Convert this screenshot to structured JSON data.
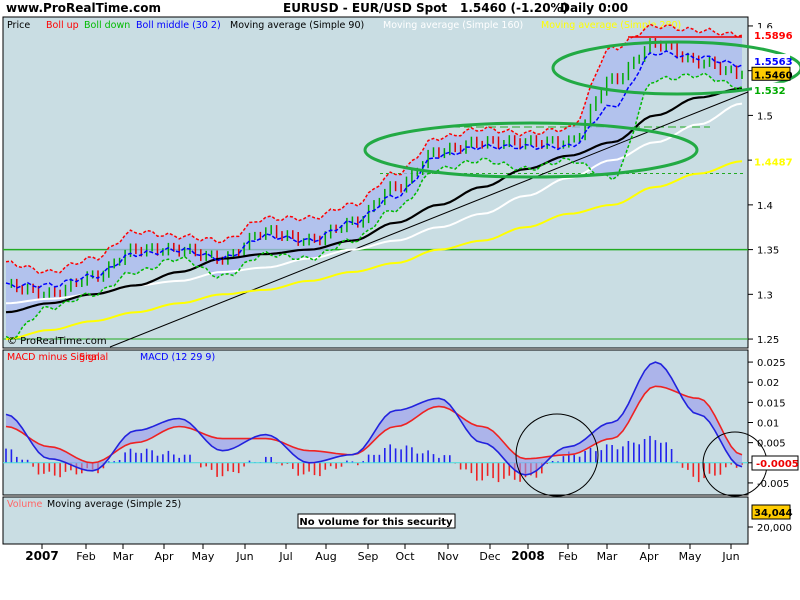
{
  "header": {
    "site": "www.ProRealTime.com",
    "symbol": "EURUSD - EUR/USD Spot",
    "quote": "1.5460 (-1.20%)",
    "period": "Daily 0:00"
  },
  "watermark": "© ProRealTime.com",
  "price_panel": {
    "legend": [
      {
        "label": "Price",
        "color": "#000000"
      },
      {
        "label": "Boll up",
        "color": "#ff0000"
      },
      {
        "label": "Boll down",
        "color": "#00bb00"
      },
      {
        "label": "Boll middle (30 2)",
        "color": "#0000ff"
      },
      {
        "label": "Moving average (Simple 90)",
        "color": "#000000"
      },
      {
        "label": "Moving average (Simple 160)",
        "color": "#ffffff"
      },
      {
        "label": "Moving average (Simple 280)",
        "color": "#ffff00"
      }
    ],
    "ticks": [
      "1.6",
      "1.55",
      "1.5",
      "1.45",
      "1.4",
      "1.35",
      "1.3",
      "1.25"
    ],
    "labels": [
      {
        "text": "1.5896",
        "bg": "#ffffff",
        "fg": "#ff0000"
      },
      {
        "text": "1.5563",
        "bg": "#ffffff",
        "fg": "#0000ff"
      },
      {
        "text": "1.5460",
        "bg": "#ffcc00",
        "fg": "#000000"
      },
      {
        "text": "1.532",
        "bg": "#ffffff",
        "fg": "#00aa00"
      },
      {
        "text": "1.5132",
        "bg": "#ffffff",
        "fg": "#ffffff"
      },
      {
        "text": "1.4487",
        "bg": "#ffffff",
        "fg": "#ffff00"
      }
    ]
  },
  "macd_panel": {
    "legend": [
      {
        "label": "MACD minus Signal",
        "color": "#ff0000"
      },
      {
        "label": "Signal",
        "color": "#ff0000"
      },
      {
        "label": "MACD (12 29 9)",
        "color": "#0000ff"
      }
    ],
    "ticks": [
      "0.025",
      "0.02",
      "0.015",
      "0.01",
      "0.005",
      "0",
      "-0.005"
    ],
    "value_label": "-0.0005"
  },
  "volume_panel": {
    "legend": [
      {
        "label": "Volume",
        "color": "#ff6666"
      },
      {
        "label": "Moving average (Simple 25)",
        "color": "#000000"
      }
    ],
    "message": "No volume for this security",
    "value_label": "34,044",
    "tick": "20,000"
  },
  "x_axis": {
    "labels": [
      "2007",
      "Feb",
      "Mar",
      "Apr",
      "May",
      "Jun",
      "Jul",
      "Aug",
      "Sep",
      "Oct",
      "Nov",
      "Dec",
      "2008",
      "Feb",
      "Mar",
      "Apr",
      "May",
      "Jun"
    ]
  },
  "colors": {
    "panel_bg": "#c9dde3",
    "band_fill": "#aab8f0",
    "annotation_green": "#22aa44"
  },
  "chart_data": [
    {
      "type": "line",
      "title": "EURUSD - EUR/USD Spot",
      "x": [
        "2007-01",
        "2007-02",
        "2007-03",
        "2007-04",
        "2007-05",
        "2007-06",
        "2007-07",
        "2007-08",
        "2007-09",
        "2007-10",
        "2007-11",
        "2007-12",
        "2008-01",
        "2008-02",
        "2008-03",
        "2008-04",
        "2008-05",
        "2008-06"
      ],
      "ylim": [
        1.24,
        1.61
      ],
      "series": [
        {
          "name": "Price",
          "values": [
            1.31,
            1.3,
            1.32,
            1.35,
            1.35,
            1.34,
            1.37,
            1.36,
            1.38,
            1.42,
            1.46,
            1.47,
            1.47,
            1.47,
            1.54,
            1.58,
            1.56,
            1.546
          ]
        },
        {
          "name": "Boll up",
          "values": [
            1.335,
            1.325,
            1.34,
            1.37,
            1.365,
            1.36,
            1.385,
            1.385,
            1.4,
            1.435,
            1.475,
            1.485,
            1.48,
            1.485,
            1.575,
            1.6,
            1.595,
            1.5896
          ]
        },
        {
          "name": "Boll down",
          "values": [
            1.25,
            1.285,
            1.3,
            1.325,
            1.34,
            1.32,
            1.345,
            1.34,
            1.36,
            1.395,
            1.44,
            1.45,
            1.44,
            1.45,
            1.43,
            1.54,
            1.545,
            1.532
          ]
        },
        {
          "name": "Boll middle (30 2)",
          "values": [
            1.31,
            1.31,
            1.32,
            1.345,
            1.35,
            1.34,
            1.365,
            1.36,
            1.38,
            1.41,
            1.455,
            1.465,
            1.465,
            1.465,
            1.51,
            1.57,
            1.565,
            1.5563
          ]
        },
        {
          "name": "Moving average (Simple 90)",
          "values": [
            1.28,
            1.29,
            1.3,
            1.31,
            1.325,
            1.34,
            1.345,
            1.35,
            1.36,
            1.38,
            1.4,
            1.42,
            1.44,
            1.455,
            1.47,
            1.5,
            1.52,
            1.53
          ]
        },
        {
          "name": "Moving average (Simple 160)",
          "values": [
            1.29,
            1.295,
            1.3,
            1.31,
            1.315,
            1.325,
            1.33,
            1.34,
            1.35,
            1.36,
            1.375,
            1.39,
            1.41,
            1.43,
            1.45,
            1.47,
            1.49,
            1.5132
          ]
        },
        {
          "name": "Moving average (Simple 280)",
          "values": [
            1.25,
            1.26,
            1.27,
            1.28,
            1.29,
            1.3,
            1.305,
            1.315,
            1.325,
            1.335,
            1.35,
            1.36,
            1.375,
            1.39,
            1.4,
            1.42,
            1.435,
            1.4487
          ]
        }
      ]
    },
    {
      "type": "line",
      "title": "MACD (12 29 9)",
      "x": [
        "2007-01",
        "2007-02",
        "2007-03",
        "2007-04",
        "2007-05",
        "2007-06",
        "2007-07",
        "2007-08",
        "2007-09",
        "2007-10",
        "2007-11",
        "2007-12",
        "2008-01",
        "2008-02",
        "2008-03",
        "2008-04",
        "2008-05",
        "2008-06"
      ],
      "ylim": [
        -0.008,
        0.028
      ],
      "series": [
        {
          "name": "MACD (12 29 9)",
          "values": [
            0.012,
            0.001,
            -0.002,
            0.008,
            0.011,
            0.003,
            0.007,
            0.0,
            0.002,
            0.013,
            0.016,
            0.005,
            -0.003,
            0.004,
            0.01,
            0.025,
            0.012,
            -0.001
          ]
        },
        {
          "name": "Signal",
          "values": [
            0.009,
            0.004,
            0.0,
            0.005,
            0.009,
            0.006,
            0.006,
            0.003,
            0.002,
            0.009,
            0.014,
            0.009,
            0.001,
            0.002,
            0.006,
            0.019,
            0.016,
            0.002
          ]
        },
        {
          "name": "MACD minus Signal",
          "values": [
            0.003,
            -0.003,
            -0.002,
            0.003,
            0.002,
            -0.003,
            0.001,
            -0.003,
            0.0,
            0.004,
            0.002,
            -0.004,
            -0.004,
            0.002,
            0.004,
            0.006,
            -0.004,
            -0.0005
          ]
        }
      ]
    }
  ]
}
